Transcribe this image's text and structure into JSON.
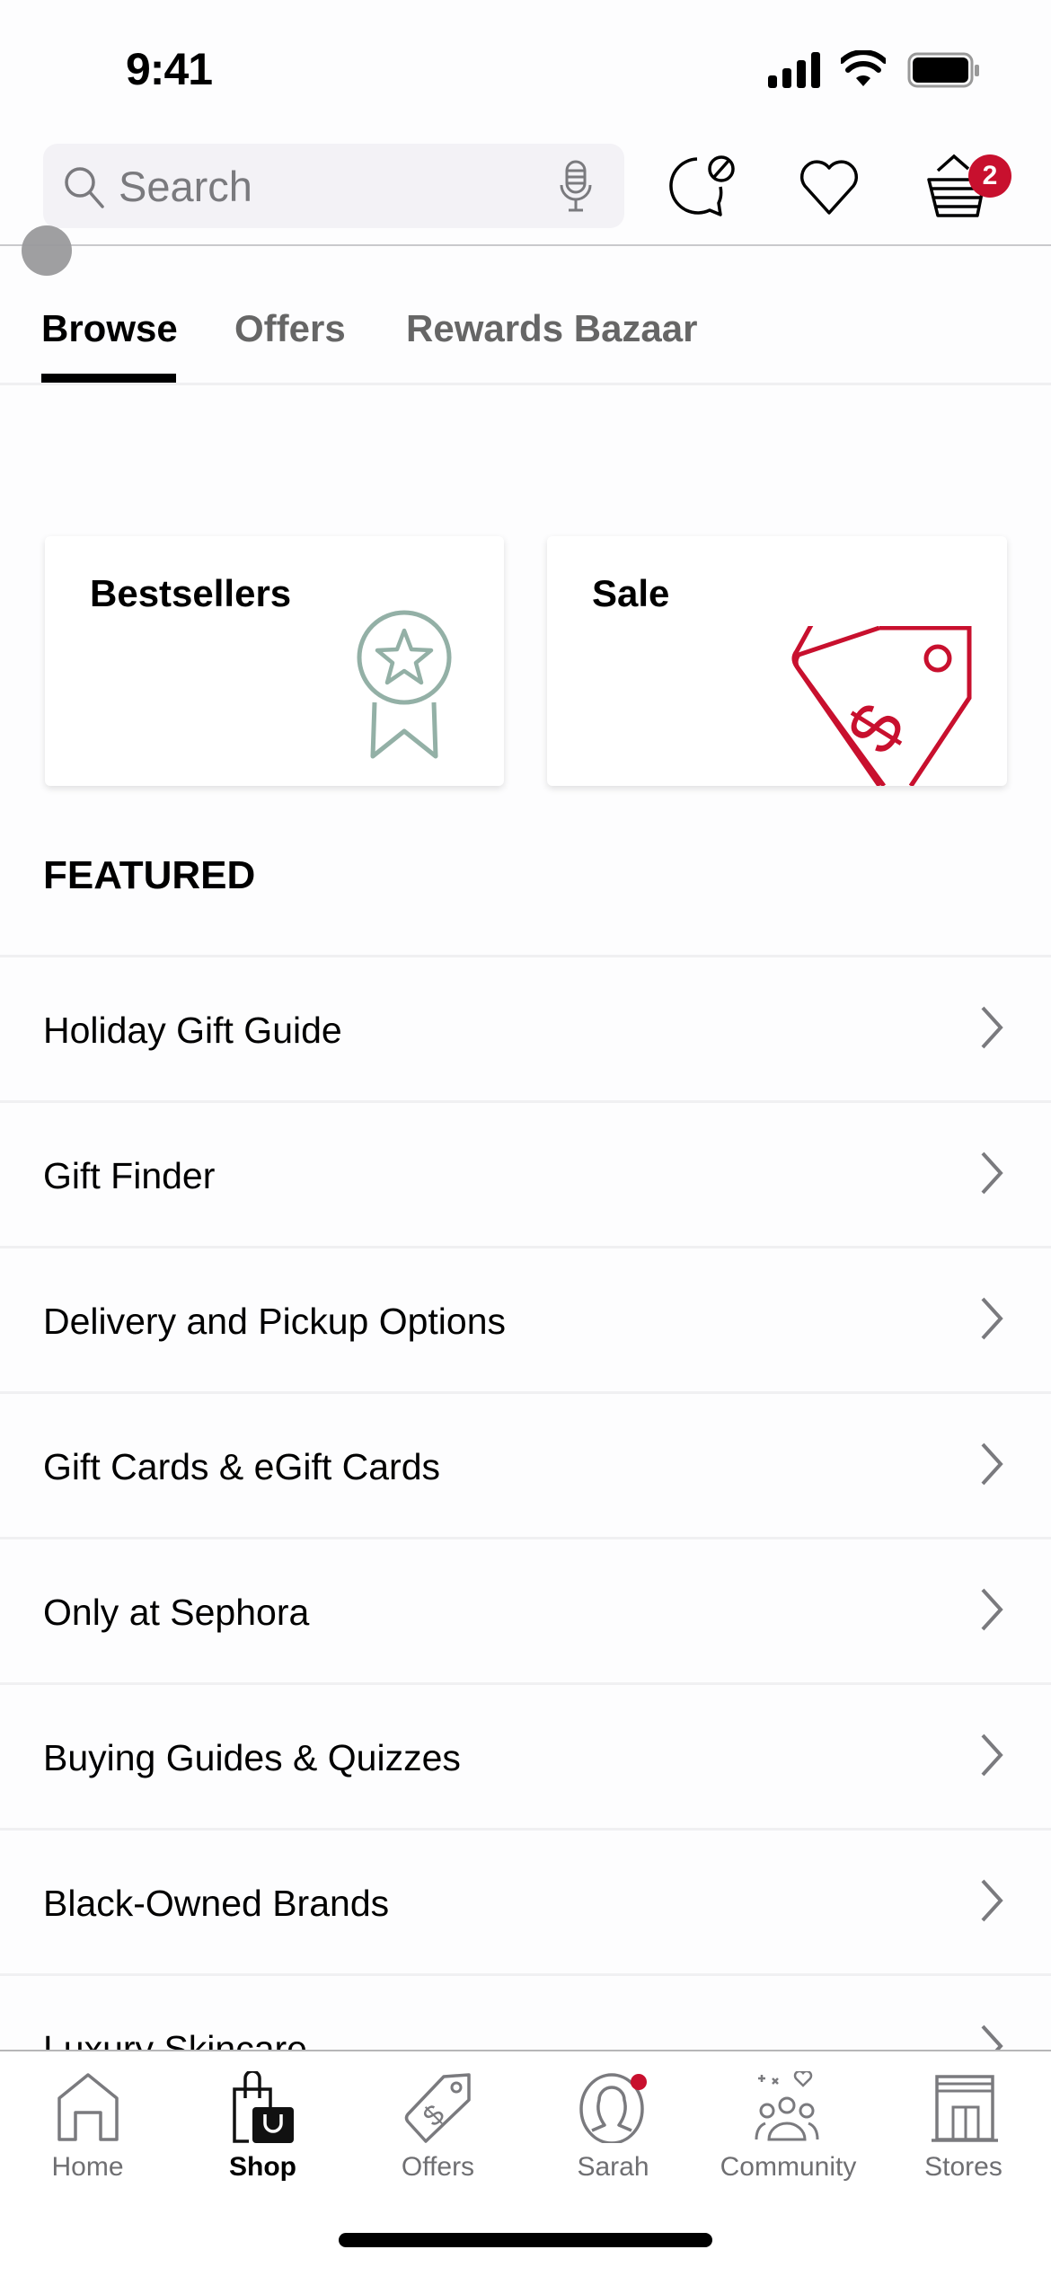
{
  "status_bar": {
    "time": "9:41"
  },
  "header": {
    "search": {
      "placeholder": "Search"
    },
    "icons": [
      "chat-icon",
      "heart-icon",
      "basket-icon"
    ],
    "basket_count": "2"
  },
  "top_tabs": [
    {
      "label": "Browse",
      "active": true
    },
    {
      "label": "Offers",
      "active": false
    },
    {
      "label": "Rewards Bazaar",
      "active": false
    }
  ],
  "cards": [
    {
      "title": "",
      "icon": "gift-card-tag-icon"
    },
    {
      "title": "",
      "icon": "gift-box-icon"
    },
    {
      "title": "Bestsellers",
      "icon": "award-ribbon-icon"
    },
    {
      "title": "Sale",
      "icon": "price-tag-icon"
    }
  ],
  "featured": {
    "heading": "FEATURED",
    "items": [
      "Holiday Gift Guide",
      "Gift Finder",
      "Delivery and Pickup Options",
      "Gift Cards & eGift Cards",
      "Only at Sephora",
      "Buying Guides & Quizzes",
      "Black-Owned Brands",
      "Luxury Skincare"
    ]
  },
  "bottom_nav": [
    {
      "label": "Home",
      "icon": "home-icon",
      "active": false
    },
    {
      "label": "Shop",
      "icon": "shopping-bag-icon",
      "active": true
    },
    {
      "label": "Offers",
      "icon": "price-tag-icon",
      "active": false
    },
    {
      "label": "Sarah",
      "icon": "profile-icon",
      "active": false,
      "notification": true
    },
    {
      "label": "Community",
      "icon": "community-icon",
      "active": false
    },
    {
      "label": "Stores",
      "icon": "store-icon",
      "active": false
    }
  ],
  "colors": {
    "accent": "#c8102e",
    "sage": "#93b0a6",
    "inactive": "#6f6f72"
  }
}
